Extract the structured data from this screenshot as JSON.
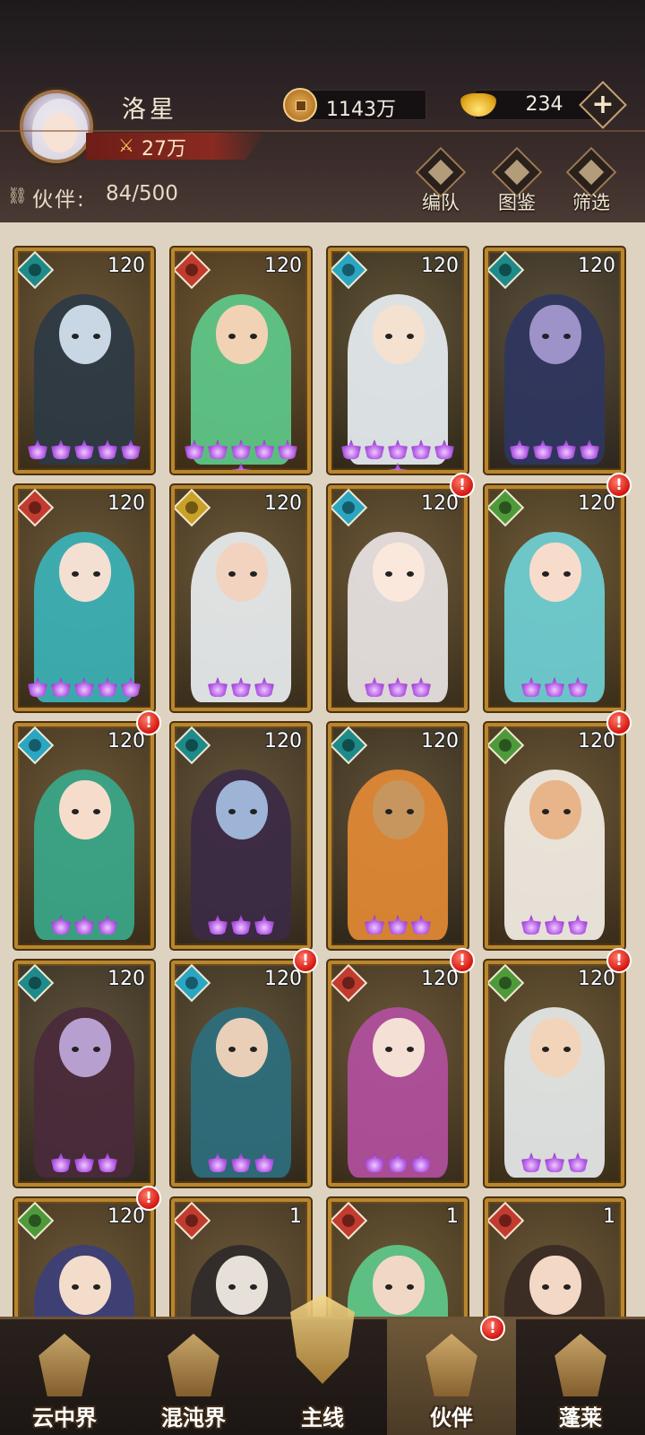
{
  "player": {
    "name": "洛星",
    "power": "27万"
  },
  "currencies": {
    "coins": "1143万",
    "ingots": "234"
  },
  "partners": {
    "label": "伙伴:",
    "count": "84/500"
  },
  "tools": {
    "team": "编队",
    "codex": "图鉴",
    "filter": "筛选"
  },
  "cards": [
    {
      "level": "120",
      "stars": 5,
      "element": "teal",
      "badge": false,
      "bg": "#4b3a22",
      "skin": "#c9d6e3",
      "cloth": "#2d3a45"
    },
    {
      "level": "120",
      "stars": 6,
      "element": "red",
      "badge": false,
      "bg": "#4e3a1e",
      "skin": "#f2d2b4",
      "cloth": "#5ec98a"
    },
    {
      "level": "120",
      "stars": 6,
      "element": "cyan",
      "badge": false,
      "bg": "#3e3522",
      "skin": "#f5e1d0",
      "cloth": "#e7eef2"
    },
    {
      "level": "120",
      "stars": 4,
      "element": "teal",
      "badge": false,
      "bg": "#3a3227",
      "skin": "#9e93c9",
      "cloth": "#2f3660"
    },
    {
      "level": "120",
      "stars": 5,
      "element": "red",
      "badge": false,
      "bg": "#4a3a22",
      "skin": "#f3e0d2",
      "cloth": "#3bb3b8"
    },
    {
      "level": "120",
      "stars": 3,
      "element": "yellow",
      "badge": false,
      "bg": "#4a3b24",
      "skin": "#f1d3c0",
      "cloth": "#e9eef0"
    },
    {
      "level": "120",
      "stars": 3,
      "element": "cyan",
      "badge": true,
      "bg": "#4c3c24",
      "skin": "#fbe8dc",
      "cloth": "#e9e4e4"
    },
    {
      "level": "120",
      "stars": 3,
      "element": "green",
      "badge": true,
      "bg": "#4d3d22",
      "skin": "#f7dccb",
      "cloth": "#6fd0d6"
    },
    {
      "level": "120",
      "stars": 3,
      "element": "cyan",
      "badge": true,
      "bg": "#4b3a22",
      "skin": "#f6ddcb",
      "cloth": "#3aa88a"
    },
    {
      "level": "120",
      "stars": 3,
      "element": "teal",
      "badge": false,
      "bg": "#433625",
      "skin": "#9db4d7",
      "cloth": "#3b2a45"
    },
    {
      "level": "120",
      "stars": 3,
      "element": "teal",
      "badge": false,
      "bg": "#3d3222",
      "skin": "#c7965e",
      "cloth": "#e38a35"
    },
    {
      "level": "120",
      "stars": 3,
      "element": "green",
      "badge": true,
      "bg": "#4a3a22",
      "skin": "#e8b48a",
      "cloth": "#f4efe6"
    },
    {
      "level": "120",
      "stars": 3,
      "element": "teal",
      "badge": false,
      "bg": "#3d3427",
      "skin": "#b7a0cf",
      "cloth": "#4a2a3b"
    },
    {
      "level": "120",
      "stars": 3,
      "element": "cyan",
      "badge": true,
      "bg": "#3f3524",
      "skin": "#e9cfb8",
      "cloth": "#2c6f7e"
    },
    {
      "level": "120",
      "stars": 3,
      "element": "red",
      "badge": true,
      "bg": "#4a3a24",
      "skin": "#f4e0d4",
      "cloth": "#b24fa0"
    },
    {
      "level": "120",
      "stars": 3,
      "element": "green",
      "badge": true,
      "bg": "#4b3b22",
      "skin": "#f2d4bb",
      "cloth": "#e6eaea"
    },
    {
      "level": "120",
      "stars": 0,
      "element": "green",
      "badge": true,
      "bg": "#4b3a22",
      "skin": "#f4dccb",
      "cloth": "#3c3f7a"
    },
    {
      "level": "1",
      "stars": 0,
      "element": "red",
      "badge": false,
      "bg": "#4a3a24",
      "skin": "#e6e0d8",
      "cloth": "#2f2a2a"
    },
    {
      "level": "1",
      "stars": 0,
      "element": "red",
      "badge": false,
      "bg": "#4b3c22",
      "skin": "#f1d8c4",
      "cloth": "#5ec98a"
    },
    {
      "level": "1",
      "stars": 0,
      "element": "red",
      "badge": false,
      "bg": "#4a3a22",
      "skin": "#f3d8c6",
      "cloth": "#3a2a24"
    }
  ],
  "element_colors": {
    "teal": "#1f8a8a",
    "red": "#c23b2f",
    "cyan": "#2aa6c2",
    "green": "#4e9a3a",
    "yellow": "#c9a126"
  },
  "nav": {
    "items": [
      {
        "label": "云中界",
        "active": false
      },
      {
        "label": "混沌界",
        "active": false
      },
      {
        "label": "主线",
        "active": false
      },
      {
        "label": "伙伴",
        "active": true
      },
      {
        "label": "蓬莱",
        "active": false
      }
    ]
  },
  "colors": {
    "card_border": "#b8862e",
    "grid_bg": "#ddd3c0",
    "star": "#b45ce6",
    "badge": "#d3160f"
  }
}
